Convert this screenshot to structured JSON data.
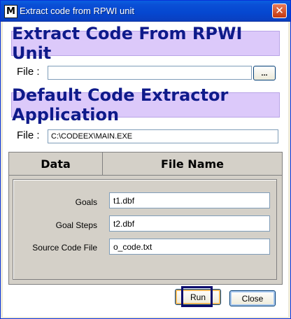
{
  "window": {
    "title": "Extract code from RPWI unit",
    "icon_letter": "M",
    "close_glyph": "✕"
  },
  "section1": {
    "banner": "Extract Code From RPWI Unit",
    "file_label": "File :",
    "file_value": "",
    "browse_label": "..."
  },
  "section2": {
    "banner": "Default Code Extractor Application",
    "file_label": "File :",
    "file_value": "C:\\CODEEX\\MAIN.EXE"
  },
  "grid": {
    "headers": [
      "Data",
      "File Name"
    ],
    "rows": [
      {
        "label": "Goals",
        "value": "t1.dbf"
      },
      {
        "label": "Goal Steps",
        "value": "t2.dbf"
      },
      {
        "label": "Source Code File",
        "value": "o_code.txt"
      }
    ]
  },
  "buttons": {
    "run": "Run",
    "close": "Close"
  },
  "colors": {
    "banner_bg": "#dcc9fa",
    "banner_text": "#0e1a8a",
    "titlebar": "#0547d0"
  }
}
